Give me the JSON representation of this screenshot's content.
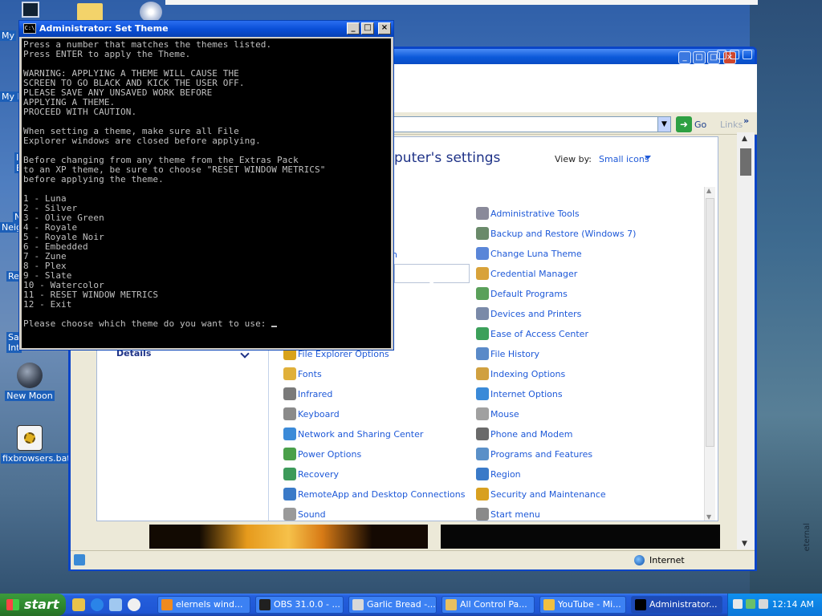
{
  "desktop": {
    "icons": [
      {
        "label": "New Moon",
        "icon": "moon-icon"
      },
      {
        "label": "fixbrowsers.bat",
        "icon": "batch-file-icon"
      }
    ],
    "edge_labels": [
      "My",
      "My D",
      "I",
      "N",
      "Neig",
      "Re",
      "Sa",
      "Int",
      "E"
    ],
    "vertical_label": "eternal"
  },
  "console": {
    "title": "Administrator: Set Theme",
    "icon_text": "C:\\",
    "lines": [
      "Press a number that matches the themes listed.",
      "Press ENTER to apply the Theme.",
      "",
      "WARNING: APPLYING A THEME WILL CAUSE THE",
      "SCREEN TO GO BLACK AND KICK THE USER OFF.",
      "PLEASE SAVE ANY UNSAVED WORK BEFORE",
      "APPLYING A THEME.",
      "PROCEED WITH CAUTION.",
      "",
      "When setting a theme, make sure all File",
      "Explorer windows are closed before applying.",
      "",
      "Before changing from any theme from the Extras Pack",
      "to an XP theme, be sure to choose \"RESET WINDOW METRICS\"",
      "before applying the theme.",
      "",
      "1 - Luna",
      "2 - Silver",
      "3 - Olive Green",
      "4 - Royale",
      "5 - Royale Noir",
      "6 - Embedded",
      "7 - Zune",
      "8 - Plex",
      "9 - Slate",
      "10 - Watercolor",
      "11 - RESET WINDOW METRICS",
      "12 - Exit",
      ""
    ],
    "prompt": "Please choose which theme do you want to use: "
  },
  "explorer": {
    "go_label": "Go",
    "links_label": "Links",
    "heading_partial": "puter's settings",
    "view_by_label": "View by:",
    "view_by_value": "Small icons",
    "partial_item": "n",
    "details_label": "Details",
    "items_col1": [
      {
        "label": "File Explorer Options",
        "color": "#d8a21c"
      },
      {
        "label": "Fonts",
        "color": "#e0b03a"
      },
      {
        "label": "Infrared",
        "color": "#7a7a7a"
      },
      {
        "label": "Keyboard",
        "color": "#8a8a8a"
      },
      {
        "label": "Network and Sharing Center",
        "color": "#3b8ad8"
      },
      {
        "label": "Power Options",
        "color": "#4aa04a"
      },
      {
        "label": "Recovery",
        "color": "#3c9a5a"
      },
      {
        "label": "RemoteApp and Desktop Connections",
        "color": "#3a7ac8"
      },
      {
        "label": "Sound",
        "color": "#9a9a9a"
      }
    ],
    "items_col2": [
      {
        "label": "Administrative Tools",
        "color": "#8a8a9a"
      },
      {
        "label": "Backup and Restore (Windows 7)",
        "color": "#6a8a6a"
      },
      {
        "label": "Change Luna Theme",
        "color": "#5a86d8"
      },
      {
        "label": "Credential Manager",
        "color": "#d8a23a"
      },
      {
        "label": "Default Programs",
        "color": "#5aa05a"
      },
      {
        "label": "Devices and Printers",
        "color": "#7a8aa8"
      },
      {
        "label": "Ease of Access Center",
        "color": "#3ca05a"
      },
      {
        "label": "File History",
        "color": "#5a8ac8"
      },
      {
        "label": "Indexing Options",
        "color": "#d0a040"
      },
      {
        "label": "Internet Options",
        "color": "#3a8ad8"
      },
      {
        "label": "Mouse",
        "color": "#a0a0a0"
      },
      {
        "label": "Phone and Modem",
        "color": "#6a6a6a"
      },
      {
        "label": "Programs and Features",
        "color": "#5a90c8"
      },
      {
        "label": "Region",
        "color": "#3a7ac8"
      },
      {
        "label": "Security and Maintenance",
        "color": "#d8a020"
      },
      {
        "label": "Start menu",
        "color": "#8a8a8a"
      }
    ],
    "status_zone": "Internet"
  },
  "taskbar": {
    "start_label": "start",
    "tasks": [
      {
        "label": "elernels wind...",
        "icon_color": "#f08a20"
      },
      {
        "label": "OBS 31.0.0 - ...",
        "icon_color": "#202020"
      },
      {
        "label": "Garlic Bread -...",
        "icon_color": "#d8d8d8"
      },
      {
        "label": "All Control Pa...",
        "icon_color": "#e8c060"
      },
      {
        "label": "YouTube - Mi...",
        "icon_color": "#f0c040"
      },
      {
        "label": "Administrator...",
        "icon_color": "#000000"
      }
    ],
    "clock": "12:14 AM"
  }
}
